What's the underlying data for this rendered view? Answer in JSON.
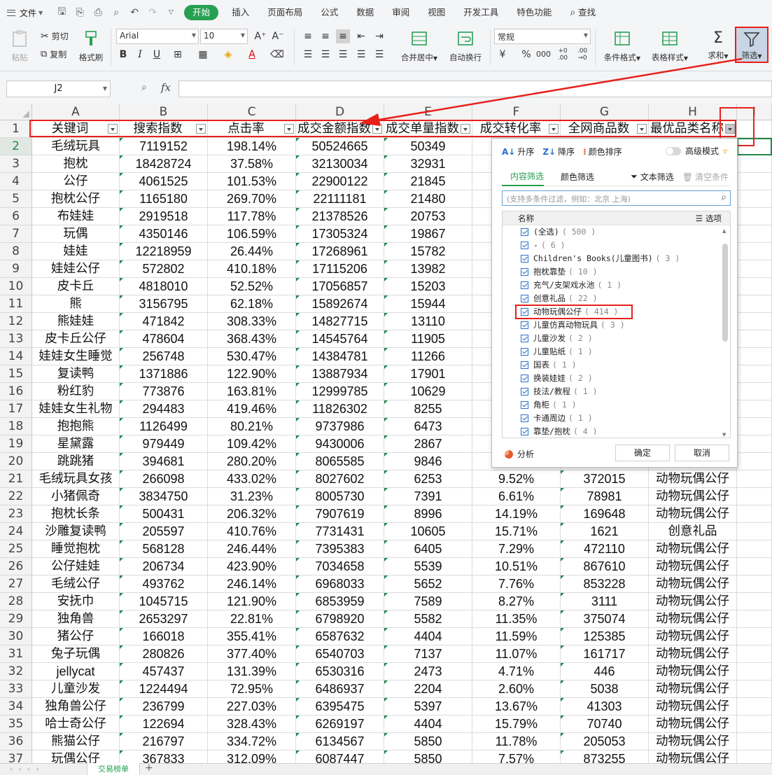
{
  "menu": {
    "file": "文件",
    "tabs": [
      "开始",
      "插入",
      "页面布局",
      "公式",
      "数据",
      "审阅",
      "视图",
      "开发工具",
      "特色功能"
    ],
    "search": "查找",
    "active_tab_color": "#27a053"
  },
  "ribbon": {
    "paste": "粘贴",
    "cut": "剪切",
    "copy": "复制",
    "format_painter": "格式刷",
    "font_name": "Arial",
    "font_size": "10",
    "merge_center": "合并居中",
    "wrap_text": "自动换行",
    "number_format": "常规",
    "cond_format": "条件格式",
    "table_style": "表格样式",
    "sum": "求和",
    "filter": "筛选"
  },
  "formula_bar": {
    "name_box": "J2",
    "fx": "fx",
    "formula": ""
  },
  "grid": {
    "columns": [
      "A",
      "B",
      "C",
      "D",
      "E",
      "F",
      "G",
      "H",
      "I"
    ],
    "headers": [
      "关键词",
      "搜索指数",
      "点击率",
      "成交金额指数",
      "成交单量指数",
      "成交转化率",
      "全网商品数",
      "最优品类名称"
    ],
    "rows": [
      {
        "n": "2",
        "a": "毛绒玩具",
        "b": "7119152",
        "c": "198.14%",
        "d": "50524665",
        "e": "50349"
      },
      {
        "n": "3",
        "a": "抱枕",
        "b": "18428724",
        "c": "37.58%",
        "d": "32130034",
        "e": "32931"
      },
      {
        "n": "4",
        "a": "公仔",
        "b": "4061525",
        "c": "101.53%",
        "d": "22900122",
        "e": "21845"
      },
      {
        "n": "5",
        "a": "抱枕公仔",
        "b": "1165180",
        "c": "269.70%",
        "d": "22111181",
        "e": "21480"
      },
      {
        "n": "6",
        "a": "布娃娃",
        "b": "2919518",
        "c": "117.78%",
        "d": "21378526",
        "e": "20753"
      },
      {
        "n": "7",
        "a": "玩偶",
        "b": "4350146",
        "c": "106.59%",
        "d": "17305324",
        "e": "19867"
      },
      {
        "n": "8",
        "a": "娃娃",
        "b": "12218959",
        "c": "26.44%",
        "d": "17268961",
        "e": "15782"
      },
      {
        "n": "9",
        "a": "娃娃公仔",
        "b": "572802",
        "c": "410.18%",
        "d": "17115206",
        "e": "13982"
      },
      {
        "n": "10",
        "a": "皮卡丘",
        "b": "4818010",
        "c": "52.52%",
        "d": "17056857",
        "e": "15203"
      },
      {
        "n": "11",
        "a": "熊",
        "b": "3156795",
        "c": "62.18%",
        "d": "15892674",
        "e": "15944"
      },
      {
        "n": "12",
        "a": "熊娃娃",
        "b": "471842",
        "c": "308.33%",
        "d": "14827715",
        "e": "13110"
      },
      {
        "n": "13",
        "a": "皮卡丘公仔",
        "b": "478604",
        "c": "368.43%",
        "d": "14545764",
        "e": "11905"
      },
      {
        "n": "14",
        "a": "娃娃女生睡觉",
        "b": "256748",
        "c": "530.47%",
        "d": "14384781",
        "e": "11266"
      },
      {
        "n": "15",
        "a": "复读鸭",
        "b": "1371886",
        "c": "122.90%",
        "d": "13887934",
        "e": "17901"
      },
      {
        "n": "16",
        "a": "粉红豹",
        "b": "773876",
        "c": "163.81%",
        "d": "12999785",
        "e": "10629"
      },
      {
        "n": "17",
        "a": "娃娃女生礼物",
        "b": "294483",
        "c": "419.46%",
        "d": "11826302",
        "e": "8255"
      },
      {
        "n": "18",
        "a": "抱抱熊",
        "b": "1126499",
        "c": "80.21%",
        "d": "9737986",
        "e": "6473"
      },
      {
        "n": "19",
        "a": "星黛露",
        "b": "979449",
        "c": "109.42%",
        "d": "9430006",
        "e": "2867"
      },
      {
        "n": "20",
        "a": "跳跳猪",
        "b": "394681",
        "c": "280.20%",
        "d": "8065585",
        "e": "9846"
      },
      {
        "n": "21",
        "a": "毛绒玩具女孩",
        "b": "266098",
        "c": "433.02%",
        "d": "8027602",
        "e": "6253",
        "f": "9.52%",
        "g": "372015",
        "h": "动物玩偶公仔"
      },
      {
        "n": "22",
        "a": "小猪佩奇",
        "b": "3834750",
        "c": "31.23%",
        "d": "8005730",
        "e": "7391",
        "f": "6.61%",
        "g": "78981",
        "h": "动物玩偶公仔"
      },
      {
        "n": "23",
        "a": "抱枕长条",
        "b": "500431",
        "c": "206.32%",
        "d": "7907619",
        "e": "8996",
        "f": "14.19%",
        "g": "169648",
        "h": "动物玩偶公仔"
      },
      {
        "n": "24",
        "a": "沙雕复读鸭",
        "b": "205597",
        "c": "410.76%",
        "d": "7731431",
        "e": "10605",
        "f": "15.71%",
        "g": "1621",
        "h": "创意礼品"
      },
      {
        "n": "25",
        "a": "睡觉抱枕",
        "b": "568128",
        "c": "246.44%",
        "d": "7395383",
        "e": "6405",
        "f": "7.29%",
        "g": "472110",
        "h": "动物玩偶公仔"
      },
      {
        "n": "26",
        "a": "公仔娃娃",
        "b": "206734",
        "c": "423.90%",
        "d": "7034658",
        "e": "5539",
        "f": "10.51%",
        "g": "867610",
        "h": "动物玩偶公仔"
      },
      {
        "n": "27",
        "a": "毛绒公仔",
        "b": "493762",
        "c": "246.14%",
        "d": "6968033",
        "e": "5652",
        "f": "7.76%",
        "g": "853228",
        "h": "动物玩偶公仔"
      },
      {
        "n": "28",
        "a": "安抚巾",
        "b": "1045715",
        "c": "121.90%",
        "d": "6853959",
        "e": "7589",
        "f": "8.27%",
        "g": "3111",
        "h": "动物玩偶公仔"
      },
      {
        "n": "29",
        "a": "独角兽",
        "b": "2653297",
        "c": "22.81%",
        "d": "6798920",
        "e": "5582",
        "f": "11.35%",
        "g": "375074",
        "h": "动物玩偶公仔"
      },
      {
        "n": "30",
        "a": "猪公仔",
        "b": "166018",
        "c": "355.41%",
        "d": "6587632",
        "e": "4404",
        "f": "11.59%",
        "g": "125385",
        "h": "动物玩偶公仔"
      },
      {
        "n": "31",
        "a": "兔子玩偶",
        "b": "280826",
        "c": "377.40%",
        "d": "6540703",
        "e": "7137",
        "f": "11.07%",
        "g": "161717",
        "h": "动物玩偶公仔"
      },
      {
        "n": "32",
        "a": "jellycat",
        "b": "457437",
        "c": "131.39%",
        "d": "6530316",
        "e": "2473",
        "f": "4.71%",
        "g": "446",
        "h": "动物玩偶公仔"
      },
      {
        "n": "33",
        "a": "儿童沙发",
        "b": "1224494",
        "c": "72.95%",
        "d": "6486937",
        "e": "2204",
        "f": "2.60%",
        "g": "5038",
        "h": "动物玩偶公仔"
      },
      {
        "n": "34",
        "a": "独角兽公仔",
        "b": "236799",
        "c": "227.03%",
        "d": "6395475",
        "e": "5397",
        "f": "13.67%",
        "g": "41303",
        "h": "动物玩偶公仔"
      },
      {
        "n": "35",
        "a": "哈士奇公仔",
        "b": "122694",
        "c": "328.43%",
        "d": "6269197",
        "e": "4404",
        "f": "15.79%",
        "g": "70740",
        "h": "动物玩偶公仔"
      },
      {
        "n": "36",
        "a": "熊猫公仔",
        "b": "216797",
        "c": "334.72%",
        "d": "6134567",
        "e": "5850",
        "f": "11.78%",
        "g": "205053",
        "h": "动物玩偶公仔"
      },
      {
        "n": "37",
        "a": "玩偶公仔",
        "b": "367833",
        "c": "312.09%",
        "d": "6087447",
        "e": "5850",
        "f": "7.57%",
        "g": "873255",
        "h": "动物玩偶公仔"
      }
    ]
  },
  "filter_panel": {
    "sort_asc": "升序",
    "sort_desc": "降序",
    "sort_color": "颜色排序",
    "advanced": "高级模式",
    "tab_content": "内容筛选",
    "tab_color": "颜色筛选",
    "text_filter": "文本筛选",
    "clear": "清空条件",
    "search_placeholder": "(支持多条件过滤，例如：北京 上海)",
    "list_header": "名称",
    "options": "选项",
    "items": [
      {
        "label": "(全选)",
        "count": "( 500 )"
      },
      {
        "label": "-",
        "count": "( 6 )"
      },
      {
        "label": "Children's Books(儿童图书)",
        "count": "( 3 )"
      },
      {
        "label": "抱枕靠垫",
        "count": "( 10 )"
      },
      {
        "label": "充气/支架戏水池",
        "count": "( 1 )"
      },
      {
        "label": "创意礼品",
        "count": "( 22 )"
      },
      {
        "label": "动物玩偶公仔",
        "count": "( 414 )"
      },
      {
        "label": "儿童仿真动物玩具",
        "count": "( 3 )"
      },
      {
        "label": "儿童沙发",
        "count": "( 2 )"
      },
      {
        "label": "儿童贴纸",
        "count": "( 1 )"
      },
      {
        "label": "国表",
        "count": "( 1 )"
      },
      {
        "label": "换装娃娃",
        "count": "( 2 )"
      },
      {
        "label": "技法/教程",
        "count": "( 1 )"
      },
      {
        "label": "角柜",
        "count": "( 1 )"
      },
      {
        "label": "卡通周边",
        "count": "( 1 )"
      },
      {
        "label": "靠垫/抱枕",
        "count": "( 4 )"
      }
    ],
    "analyze": "分析",
    "ok": "确定",
    "cancel": "取消"
  },
  "sheets": {
    "active": "交易榜单",
    "add": "+"
  },
  "colors": {
    "accent": "#27a053",
    "annotation_red": "#e8201c",
    "checkbox_blue": "#2a6fcf"
  }
}
